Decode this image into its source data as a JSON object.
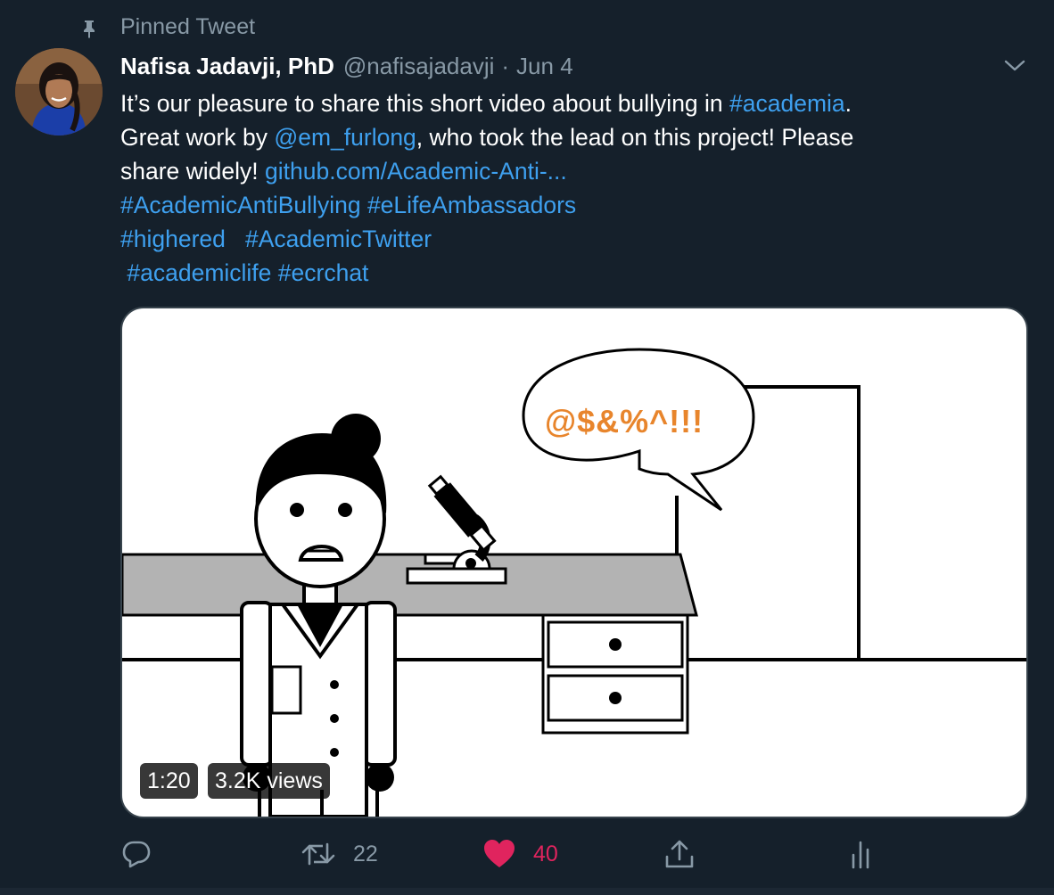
{
  "pinned": {
    "label": "Pinned Tweet"
  },
  "tweet": {
    "author_name": "Nafisa Jadavji, PhD",
    "author_handle": "@nafisajadavji",
    "separator": "·",
    "date": "Jun 4",
    "text": {
      "l1_a": "It’s our pleasure to share this short video about bullying in ",
      "l1_tag": "#academia",
      "l1_b": ".",
      "l2_a": "Great work by ",
      "l2_mention": "@em_furlong",
      "l2_b": ", who took the lead on this project! Please",
      "l3_a": "share widely! ",
      "l3_link": "github.com/Academic-Anti-...",
      "l4_tag1": "#AcademicAntiBullying",
      "l4_tag2": "#eLifeAmbassadors",
      "l5_tag1": "#highered",
      "l5_tag2": "#AcademicTwitter",
      "l6_tag1": "#academiclife",
      "l6_tag2": "#ecrchat"
    },
    "media": {
      "speech_bubble_text": "@$&%^!!!",
      "duration": "1:20",
      "views": "3.2K views"
    },
    "actions": {
      "retweet_count": "22",
      "like_count": "40"
    }
  },
  "colors": {
    "background": "#15202b",
    "secondary_text": "#8899a6",
    "link": "#3ea0ef",
    "like": "#e0245e",
    "bubble_text": "#e8852c"
  },
  "icons": [
    "pin-icon",
    "chevron-down-icon",
    "reply-icon",
    "retweet-icon",
    "heart-icon",
    "share-icon",
    "analytics-icon"
  ]
}
